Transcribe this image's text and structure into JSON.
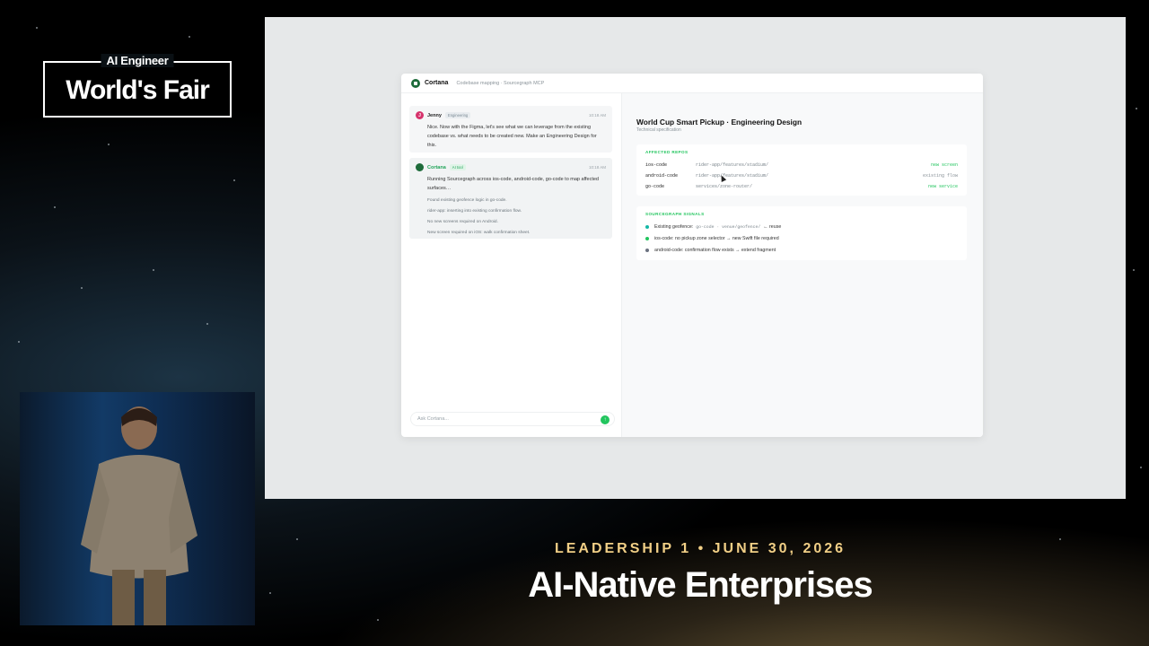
{
  "event": {
    "logo_top": "AI Engineer",
    "logo_main": "World's Fair",
    "session": "LEADERSHIP 1 • JUNE 30, 2026",
    "talk_title": "AI-Native Enterprises"
  },
  "app": {
    "name": "Cortana",
    "subtitle": "Codebase mapping · Sourcegraph MCP"
  },
  "chat": {
    "user_msg": {
      "initial": "J",
      "sender": "Jenny",
      "tag": "Engineering",
      "time": "10:18 AM",
      "text": "Nice. Now with the Figma, let's see what we can leverage from the existing codebase vs. what needs to be created new. Make an Engineering Design for this."
    },
    "bot_msg": {
      "sender": "Cortana",
      "tag": "AI tool",
      "time": "10:18 AM",
      "text": "Running Sourcegraph across ios-code, android-code, go-code to map affected surfaces…",
      "steps": [
        "Found existing geofence logic in go-code.",
        "rider-app: inserting into existing confirmation flow.",
        "No new screens required on Android.",
        "New screen required on iOS: walk confirmation sheet."
      ]
    },
    "input_placeholder": "Ask Cortana...",
    "send_icon": "↑"
  },
  "doc": {
    "title": "World Cup Smart Pickup · Engineering Design",
    "subtitle": "Technical specification",
    "repos_label": "AFFECTED REPOS",
    "repos": [
      {
        "name": "ios-code",
        "path": "rider-app/features/stadium/",
        "status": "new screen"
      },
      {
        "name": "android-code",
        "path": "rider-app/features/stadium/",
        "status": "existing flow"
      },
      {
        "name": "go-code",
        "path": "services/zone-router/",
        "status": "new service"
      }
    ],
    "signals_label": "SOURCEGRAPH SIGNALS",
    "signals": [
      {
        "lead": "Existing geofence:",
        "mono": "go-code · venue/geofence/",
        "tail": "← reuse"
      },
      {
        "lead": "ios-code: no pickup zone selector → new Swift file required",
        "mono": "",
        "tail": ""
      },
      {
        "lead": "android-code: confirmation flow exists → extend fragment",
        "mono": "",
        "tail": ""
      }
    ]
  },
  "colors": {
    "accent_green": "#22c55e",
    "brand_dark_green": "#1d6b3a",
    "session_gold": "#f1cf86"
  }
}
